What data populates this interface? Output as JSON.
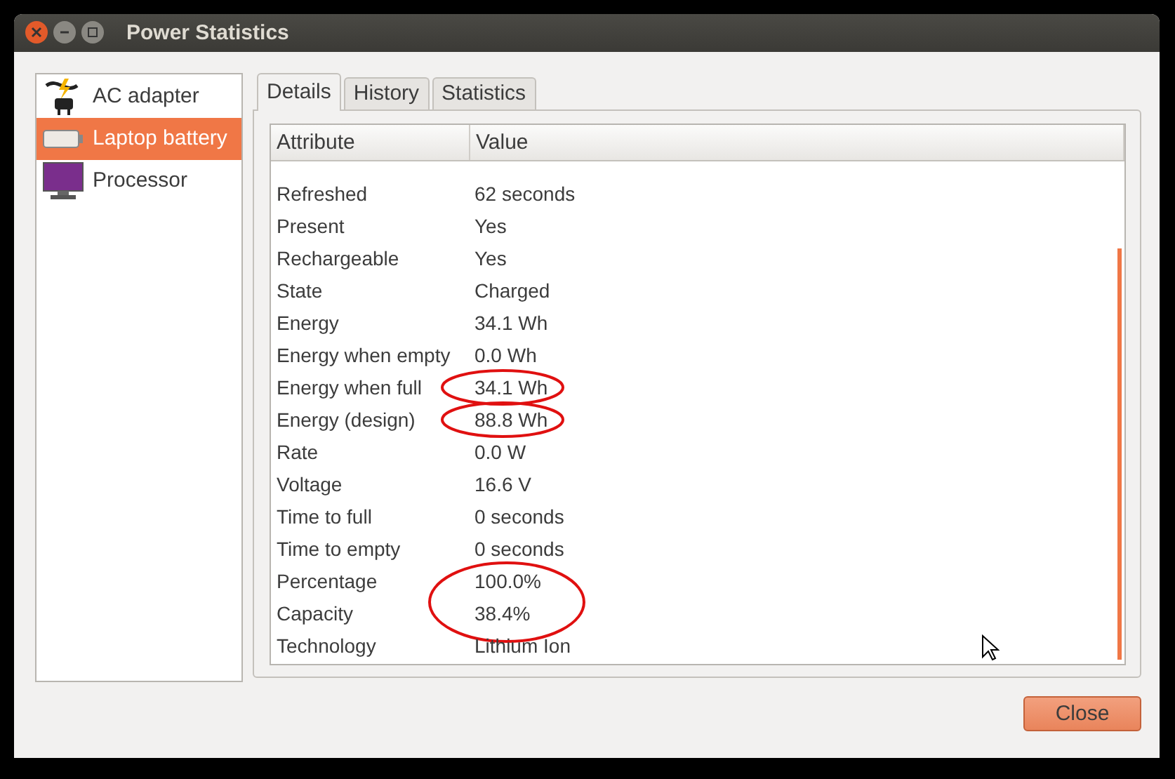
{
  "window": {
    "title": "Power Statistics"
  },
  "sidebar": {
    "items": [
      {
        "label": "AC adapter",
        "kind": "adapter",
        "selected": false
      },
      {
        "label": "Laptop battery",
        "kind": "battery",
        "selected": true
      },
      {
        "label": "Processor",
        "kind": "processor",
        "selected": false
      }
    ]
  },
  "tabs": [
    {
      "label": "Details",
      "selected": true
    },
    {
      "label": "History",
      "selected": false
    },
    {
      "label": "Statistics",
      "selected": false
    }
  ],
  "table": {
    "columns": [
      "Attribute",
      "Value"
    ],
    "rows": [
      {
        "attribute": "Refreshed",
        "value": "62 seconds"
      },
      {
        "attribute": "Present",
        "value": "Yes"
      },
      {
        "attribute": "Rechargeable",
        "value": "Yes"
      },
      {
        "attribute": "State",
        "value": "Charged"
      },
      {
        "attribute": "Energy",
        "value": "34.1 Wh"
      },
      {
        "attribute": "Energy when empty",
        "value": "0.0 Wh"
      },
      {
        "attribute": "Energy when full",
        "value": "34.1 Wh",
        "circled": true
      },
      {
        "attribute": "Energy (design)",
        "value": "88.8 Wh",
        "circled": true
      },
      {
        "attribute": "Rate",
        "value": "0.0 W"
      },
      {
        "attribute": "Voltage",
        "value": "16.6 V"
      },
      {
        "attribute": "Time to full",
        "value": "0 seconds"
      },
      {
        "attribute": "Time to empty",
        "value": "0 seconds"
      },
      {
        "attribute": "Percentage",
        "value": "100.0%",
        "circled_with_next": true
      },
      {
        "attribute": "Capacity",
        "value": "38.4%"
      },
      {
        "attribute": "Technology",
        "value": "Lithium Ion"
      }
    ]
  },
  "buttons": [
    {
      "label": "Close"
    }
  ]
}
